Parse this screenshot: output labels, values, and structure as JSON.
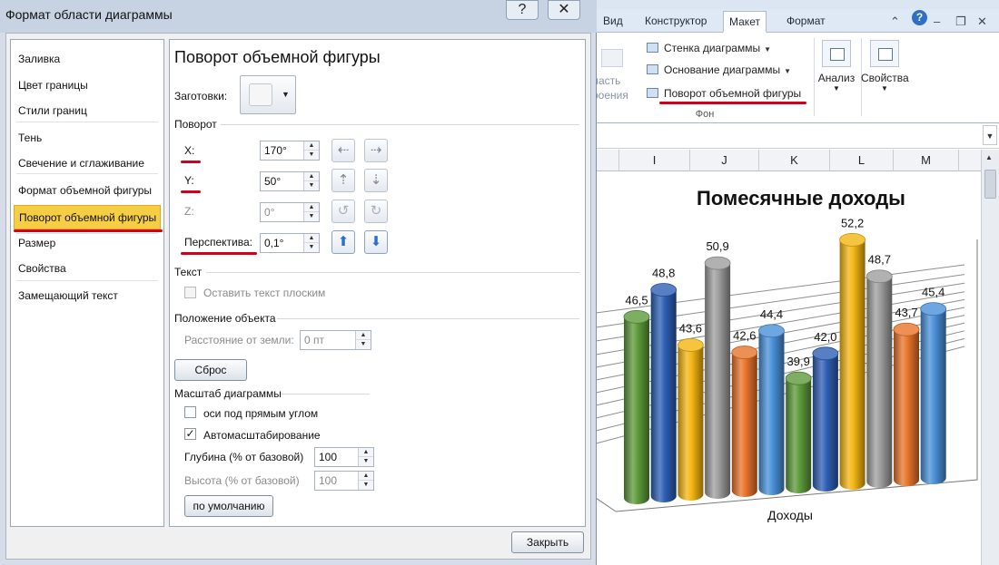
{
  "dialog": {
    "title": "Формат области диаграммы",
    "help_glyph": "?",
    "close_glyph": "✕",
    "close_button": "Закрыть"
  },
  "nav": [
    "Заливка",
    "Цвет границы",
    "Стили границ",
    "Тень",
    "Свечение и сглаживание",
    "Формат объемной фигуры",
    "Поворот объемной фигуры",
    "Размер",
    "Свойства",
    "Замещающий текст"
  ],
  "nav_selected_index": 6,
  "panel": {
    "title": "Поворот объемной фигуры",
    "presets_label": "Заготовки:",
    "rotation_section": "Поворот",
    "x_label": "X:",
    "x_value": "170°",
    "y_label": "Y:",
    "y_value": "50°",
    "z_label": "Z:",
    "z_value": "0°",
    "perspective_label": "Перспектива:",
    "perspective_value": "0,1°",
    "text_section": "Текст",
    "keep_text_flat": "Оставить текст плоским",
    "keep_text_flat_checked": false,
    "object_position_section": "Положение объекта",
    "distance_label": "Расстояние от земли:",
    "distance_value": "0 пт",
    "reset_button": "Сброс",
    "scale_section": "Масштаб диаграммы",
    "right_angle_axes": "оси под прямым углом",
    "right_angle_axes_checked": false,
    "autoscale": "Автомасштабирование",
    "autoscale_checked": true,
    "depth_label": "Глубина (% от базовой)",
    "depth_value": "100",
    "height_label": "Высота (% от базовой)",
    "height_value": "100",
    "default_button": "по умолчанию"
  },
  "ribbon": {
    "tabs": [
      "Вид",
      "Конструктор",
      "Макет",
      "Формат"
    ],
    "active_tab": "Макет",
    "left_text": [
      "ласть",
      "роения"
    ],
    "items": [
      "Стенка диаграммы",
      "Основание диаграммы",
      "Поворот объемной фигуры"
    ],
    "group_label": "Фон",
    "analysis": "Анализ",
    "properties": "Свойства",
    "help_glyph": "?"
  },
  "sheet": {
    "columns": [
      "I",
      "J",
      "K",
      "L",
      "M"
    ]
  },
  "chart_data": {
    "type": "bar",
    "subtype": "3d-cylinder",
    "title": "Помесячные доходы",
    "xlabel": "Доходы",
    "values": [
      46.5,
      48.8,
      43.6,
      50.9,
      42.6,
      44.4,
      39.9,
      42.0,
      52.2,
      48.7,
      43.7,
      45.4
    ],
    "labels": [
      "46,5",
      "48,8",
      "43,6",
      "50,9",
      "42,6",
      "44,4",
      "39,9",
      "42,0",
      "52,2",
      "48,7",
      "43,7",
      "45,4"
    ],
    "colors": [
      "#5d9a3a",
      "#2e5fb4",
      "#f3b612",
      "#9d9d9d",
      "#e8742b",
      "#4a90d9",
      "#5d9a3a",
      "#2e5fb4",
      "#f3b612",
      "#9d9d9d",
      "#e8742b",
      "#4a90d9"
    ]
  }
}
